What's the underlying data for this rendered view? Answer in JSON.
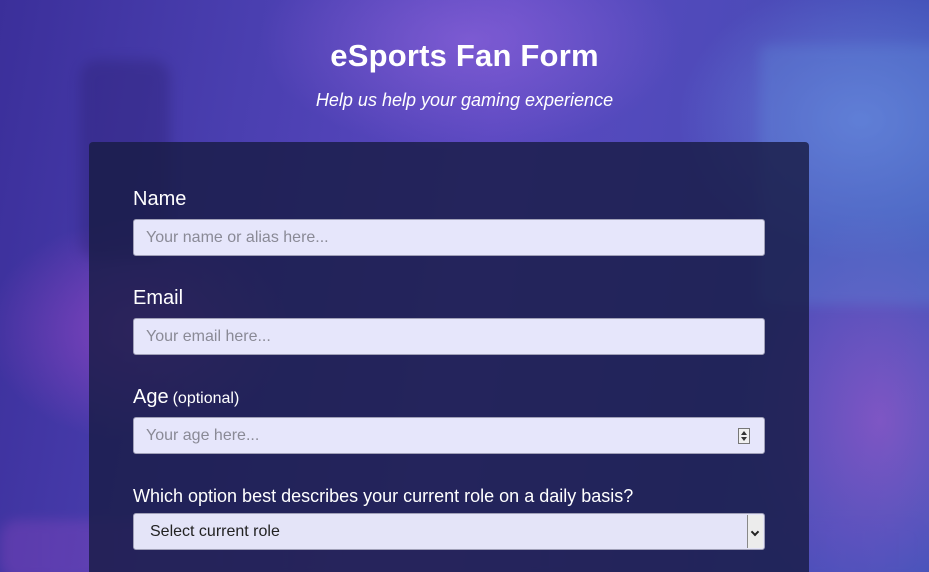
{
  "header": {
    "title": "eSports Fan Form",
    "subtitle": "Help us help your gaming experience"
  },
  "form": {
    "name": {
      "label": "Name",
      "placeholder": "Your name or alias here..."
    },
    "email": {
      "label": "Email",
      "placeholder": "Your email here..."
    },
    "age": {
      "label": "Age",
      "optional_note": "(optional)",
      "placeholder": "Your age here..."
    },
    "role": {
      "label": "Which option best describes your current role on a daily basis?",
      "selected": "Select current role"
    }
  },
  "icons": {
    "age_spinner": "number-spinner-icon",
    "role_dropdown": "chevron-down-icon"
  },
  "colors": {
    "input_background": "#e6e6fb",
    "card_background": "#191c46",
    "text": "#ffffff"
  }
}
